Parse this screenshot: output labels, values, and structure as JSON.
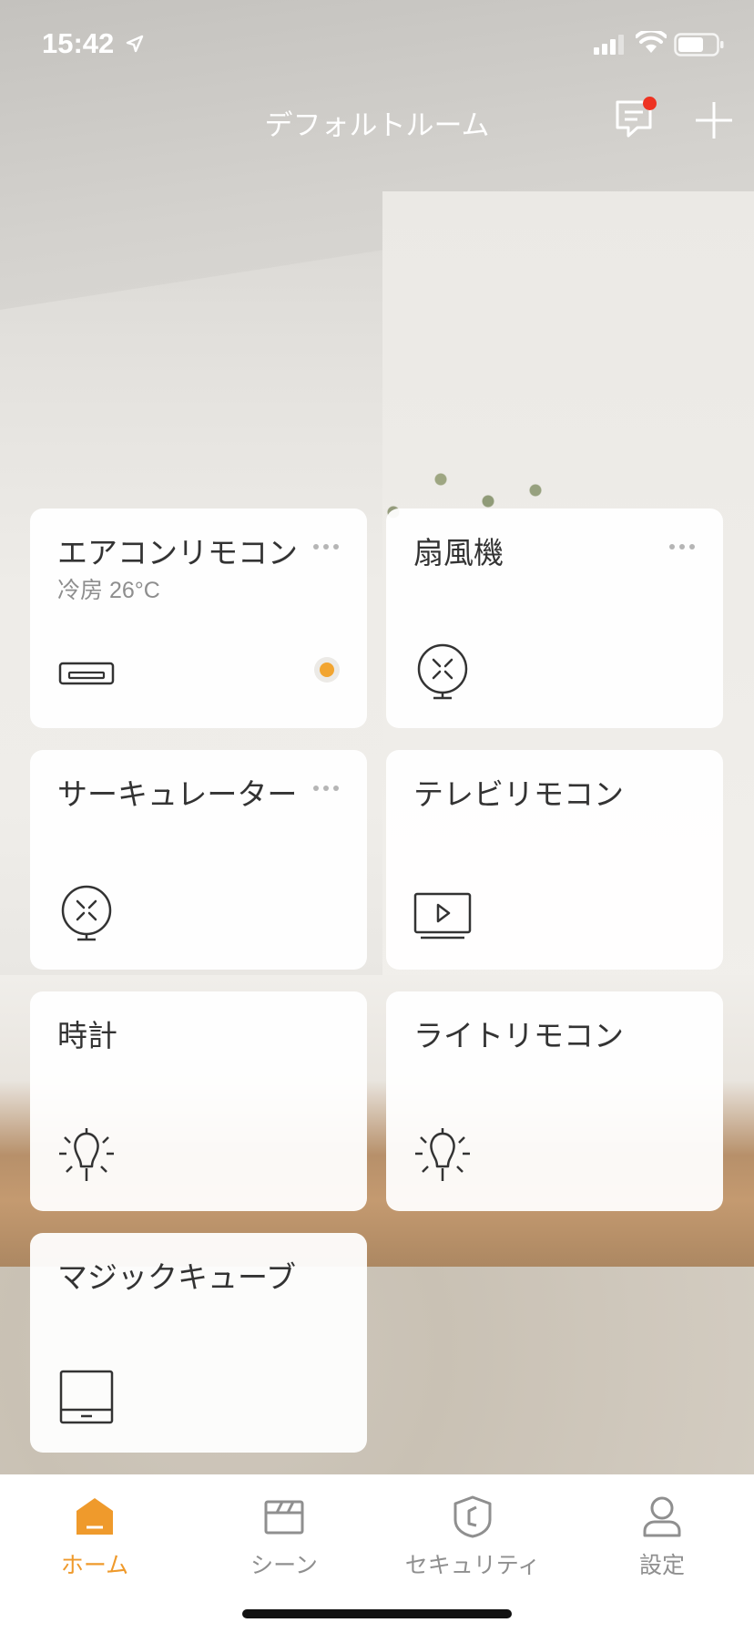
{
  "status_bar": {
    "time": "15:42",
    "icons": [
      "location-arrow-icon",
      "cellular-signal-icon",
      "wifi-icon",
      "battery-icon"
    ]
  },
  "nav": {
    "title": "デフォルトルーム",
    "message_icon": "message-icon",
    "add_icon": "plus-icon",
    "badge_color": "#ee3322"
  },
  "devices": [
    {
      "name": "エアコンリモコン",
      "status": "冷房 26°C",
      "icon": "air-conditioner-icon",
      "has_menu": true,
      "toggle_on": true
    },
    {
      "name": "扇風機",
      "status": "",
      "icon": "fan-icon",
      "has_menu": true,
      "toggle_on": false
    },
    {
      "name": "サーキュレーター",
      "status": "",
      "icon": "fan-icon",
      "has_menu": true,
      "toggle_on": false
    },
    {
      "name": "テレビリモコン",
      "status": "",
      "icon": "tv-icon",
      "has_menu": false,
      "toggle_on": false
    },
    {
      "name": "時計",
      "status": "",
      "icon": "light-bulb-icon",
      "has_menu": false,
      "toggle_on": false
    },
    {
      "name": "ライトリモコン",
      "status": "",
      "icon": "light-bulb-icon",
      "has_menu": false,
      "toggle_on": false
    },
    {
      "name": "マジックキューブ",
      "status": "",
      "icon": "cube-device-icon",
      "has_menu": false,
      "toggle_on": false
    }
  ],
  "tabs": [
    {
      "label": "ホーム",
      "icon": "home-icon",
      "active": true
    },
    {
      "label": "シーン",
      "icon": "scene-clapper-icon",
      "active": false
    },
    {
      "label": "セキュリティ",
      "icon": "security-shield-icon",
      "active": false
    },
    {
      "label": "設定",
      "icon": "user-profile-icon",
      "active": false
    }
  ],
  "colors": {
    "accent": "#ef9a2c",
    "toggle_on": "#f2a531",
    "card_text": "#333333",
    "tab_inactive": "#8f8f8f"
  }
}
